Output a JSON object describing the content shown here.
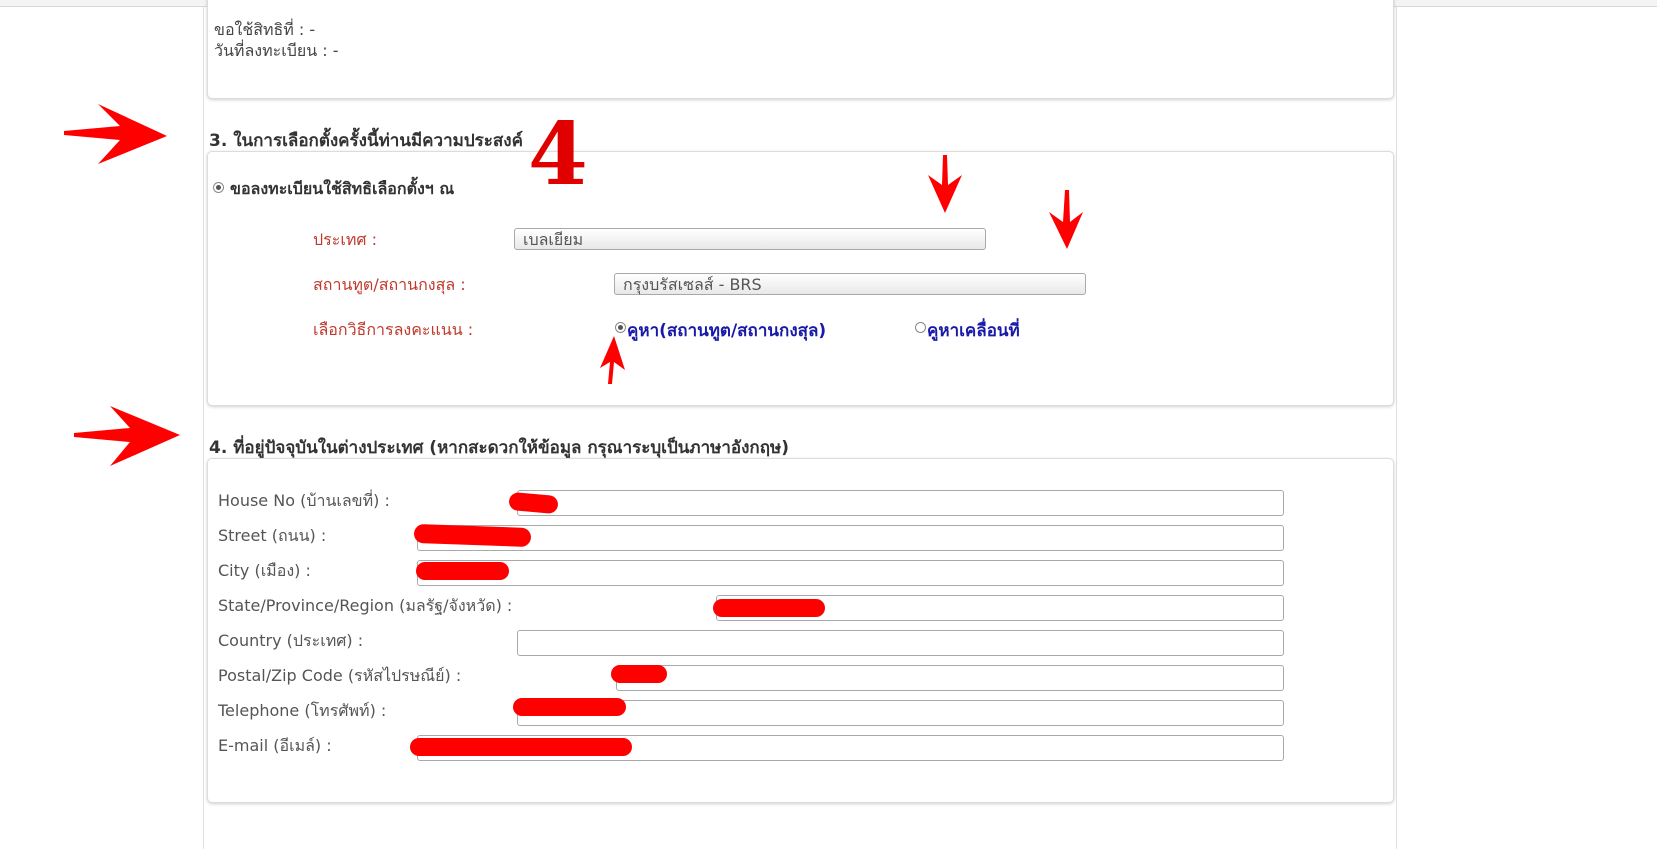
{
  "section2": {
    "right_to_vote_label": "ขอใช้สิทธิที่ : -",
    "registration_date_label": "วันที่ลงทะเบียน : -"
  },
  "annotation": {
    "step_number": "4",
    "color": "#ff0000"
  },
  "section3": {
    "heading": "3. ในการเลือกตั้งครั้งนี้ท่านมีความประสงค์",
    "register_option_label": "ขอลงทะเบียนใช้สิทธิเลือกตั้งฯ ณ",
    "country_label": "ประเทศ :",
    "country_value": "เบลเยียม",
    "embassy_label": "สถานทูต/สถานกงสุล :",
    "embassy_value": "กรุงบรัสเซลส์ - BRS",
    "voting_method_label": "เลือกวิธีการลงคะแนน :",
    "method_option_1": "คูหา(สถานทูต/สถานกงสุล)",
    "method_option_2": "คูหาเคลื่อนที่",
    "selected_method": "คูหา(สถานทูต/สถานกงสุล)"
  },
  "section4": {
    "heading": "4. ที่อยู่ปัจจุบันในต่างประเทศ (หากสะดวกให้ข้อมูล กรุณาระบุเป็นภาษาอังกฤษ)",
    "fields": [
      {
        "label": "House No (บ้านเลขที่) :"
      },
      {
        "label": "Street (ถนน) :"
      },
      {
        "label": "City (เมือง) :"
      },
      {
        "label": "State/Province/Region (มลรัฐ/จังหวัด) :"
      },
      {
        "label": "Country (ประเทศ) :"
      },
      {
        "label": "Postal/Zip Code (รหัสไปรษณีย์) :"
      },
      {
        "label": "Telephone (โทรศัพท์) :"
      },
      {
        "label": "E-mail (อีเมล์) :"
      }
    ]
  }
}
